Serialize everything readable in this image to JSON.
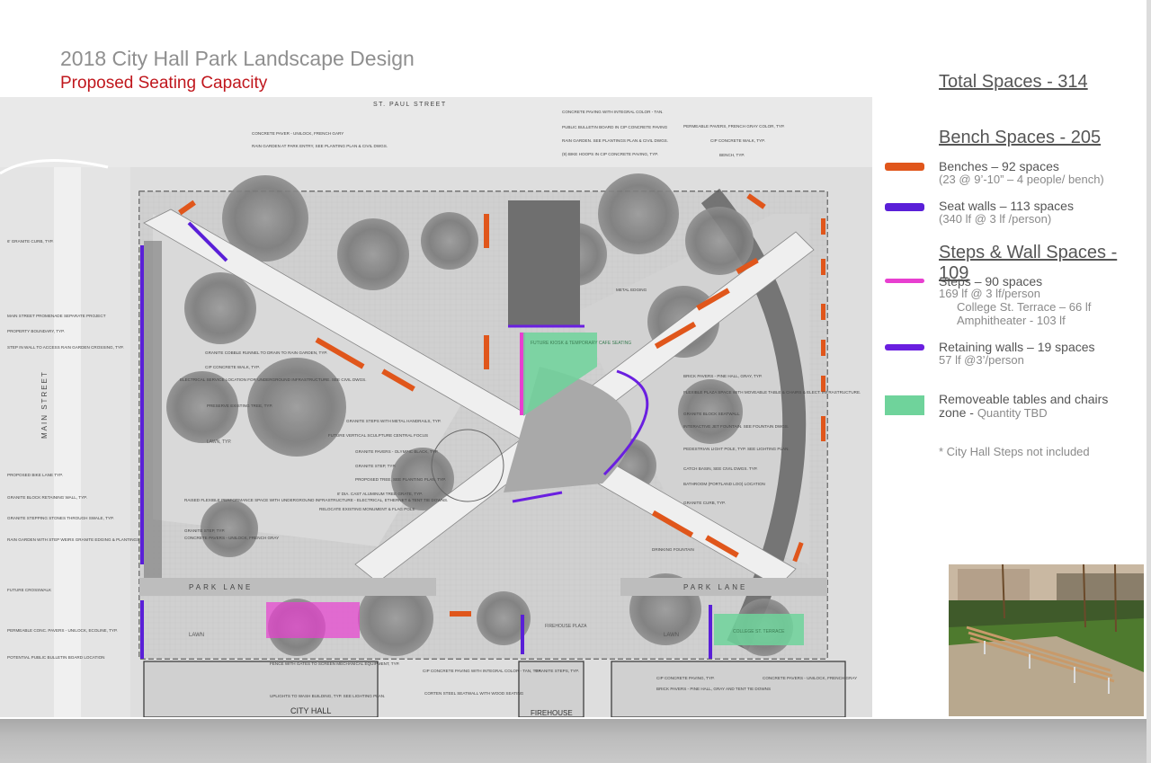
{
  "header": {
    "title": "2018 City Hall Park Landscape Design",
    "subtitle": "Proposed Seating Capacity"
  },
  "legend": {
    "total": "Total Spaces - 314",
    "bench_head": "Bench Spaces - 205",
    "benches": "Benches – 92 spaces",
    "benches_sub": "(23 @ 9’-10” – 4 people/ bench)",
    "seatwalls": "Seat walls – 113 spaces",
    "seatwalls_sub": "(340 lf @ 3 lf /person)",
    "steps_head": "Steps & Wall Spaces - 109",
    "steps": "Steps – 90 spaces",
    "steps_sub1": "169 lf @ 3 lf/person",
    "steps_sub2": "College St. Terrace – 66 lf",
    "steps_sub3": "Amphitheater - 103 lf",
    "retaining": "Retaining walls – 19 spaces",
    "retaining_sub": "57 lf @3’/person",
    "tables": "Removeable tables and chairs",
    "tables2": "zone - ",
    "tables_tbd": "Quantity TBD",
    "note": "* City Hall Steps not included",
    "colors": {
      "bench": "#e0561b",
      "seatwall": "#5a1fd8",
      "steps": "#e83fd0",
      "retaining": "#6a1fe0",
      "tables": "#6fd39b"
    }
  },
  "plan": {
    "street_top": "ST. PAUL STREET",
    "street_left": "MAIN STREET",
    "park_lane_left": "PARK LANE",
    "park_lane_right": "PARK LANE",
    "city_hall": "CITY HALL",
    "firehouse": "FIREHOUSE",
    "firehouse_plaza": "FIREHOUSE PLAZA",
    "college_terrace": "COLLEGE ST. TERRACE",
    "lawn": "LAWN",
    "lawn_typ": "LAWN, TYP.",
    "notes_left": [
      "6' GRANITE CURB, TYP.",
      "MAIN STREET PROMENADE SEPARATE PROJECT",
      "PROPERTY BOUNDARY, TYP.",
      "STEP IN WALL TO ACCESS RAIN GARDEN CROSSING, TYP.",
      "PROPOSED BIKE LANE TYP.",
      "GRANITE BLOCK RETAINING WALL, TYP.",
      "GRANITE STEPPING STONES THROUGH SWALE, TYP.",
      "RAIN GARDEN WITH STEP WEIRS GRANITE EDGING & PLANTINGS",
      "FUTURE CROSSWALK",
      "PERMEABLE CONC. PAVERS - UNILOCK, ECOLINE, TYP.",
      "POTENTIAL PUBLIC BULLETIN BOARD LOCATION"
    ],
    "notes_mid": [
      "CONCRETE PAVER - UNILOCK, FRENCH GARY",
      "RAIN GARDEN AT PARK ENTRY, SEE PLANTING PLAN & CIVIL DWGS.",
      "GRANITE COBBLE RUNNEL TO DRAIN TO RAIN GARDEN, TYP.",
      "CIP CONCRETE WALK, TYP.",
      "ELECTRICAL SERVICE LOCATION FOR UNDERGROUND INFRASTRUCTURE. SEE CIVIL DWGS.",
      "PRESERVE EXISTING TREE, TYP.",
      "RAISED FLEXIBLE PERFORMANCE SPACE WITH UNDERGROUND INFRASTRUCTURE - ELECTRICAL, ETHERNET & TENT TIE DOWNS.",
      "GRANITE STEP, TYP.",
      "CONCRETE PAVERS - UNILOCK, FRENCH GRAY",
      "FENCE WITH GATES TO SCREEN MECHANICAL EQUIPMENT, TYP.",
      "UPLIGHTS TO WASH BUILDING, TYP. SEE LIGHTING PLAN."
    ],
    "notes_center": [
      "GRANITE STEPS WITH METAL HANDRAILS, TYP.",
      "FUTURE VERTICAL SCULPTURE CENTRAL FOCUS",
      "GRANITE PAVERS - OLYMPIC BLACK, TYP.",
      "GRANITE STEP, TYP.",
      "PROPOSED TREE, SEE PLANTING PLAN, TYP.",
      "8' DIA. CAST ALUMINUM TREE GRATE, TYP.",
      "RELOCATE EXISTING MONUMENT & FLAG POLE",
      "CIP CONCRETE PAVING WITH INTEGRAL COLOR - TAN, TYP.",
      "CORTEN STEEL SEATWALL WITH WOOD SEATING",
      "GRANITE STEPS, TYP."
    ],
    "notes_top": [
      "CONCRETE PAVING WITH INTEGRAL COLOR - TAN.",
      "PUBLIC BULLETIN BOARD IN CIP CONCRETE PAVING",
      "RAIN GARDEN. SEE PLANTINGS PLAN & CIVIL DWGS.",
      "(9) BIKE HOOPS IN CIP CONCRETE PAVING, TYP."
    ],
    "notes_right": [
      "PERMEABLE PAVERS, FRENCH GRAY COLOR, TYP.",
      "CIP CONCRETE WALK, TYP.",
      "BENCH, TYP.",
      "METAL EDGING",
      "BRICK PAVERS - PINE HALL, GRAY, TYP.",
      "FLEXIBLE PLAZA SPACE WITH MOVEABLE TABLE & CHAIRS & ELECT. INFRASTRUCTURE.",
      "GRANITE BLOCK SEATWALL",
      "INTERACTIVE JET FOUNTAIN. SEE FOUNTAIN DWGS.",
      "PEDESTRIAN LIGHT POLE, TYP. SEE LIGHTING PLAN.",
      "CATCH BASIN, SEE CIVIL DWGS. TYP.",
      "BATHROOM (PORTLAND LOO) LOCATION",
      "GRANITE CURB, TYP.",
      "DRINKING FOUNTAIN",
      "CIP CONCRETE PAVING, TYP.",
      "BRICK PAVERS - PINE HALL, GRAY AND TENT TIE DOWNS",
      "CONCRETE PAVERS - UNILOCK, FRENCH GRAY"
    ],
    "kiosk": "FUTURE KIOSK & TEMPORARY CAFE SEATING"
  }
}
